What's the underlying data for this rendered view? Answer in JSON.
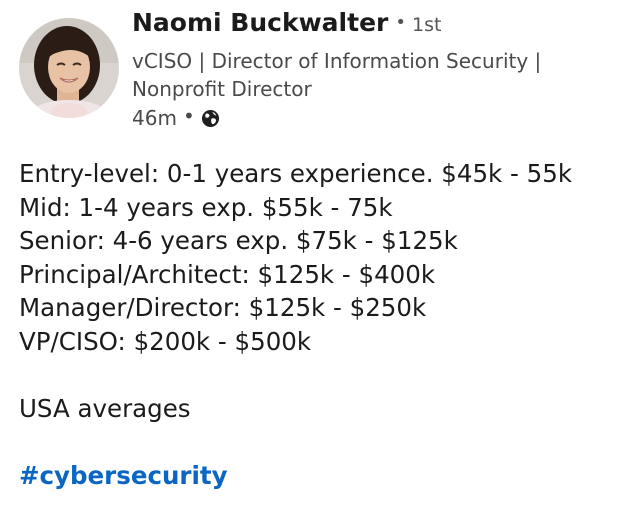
{
  "post": {
    "author": {
      "name": "Naomi Buckwalter",
      "degree": "1st",
      "separator": "•",
      "headline": "vCISO | Director of Information Security | Nonprofit Director",
      "time_ago": "46m",
      "visibility_icon": "globe-icon"
    },
    "body": {
      "lines": [
        "Entry-level: 0-1 years experience. $45k - 55k",
        "Mid: 1-4 years exp. $55k - 75k",
        "Senior: 4-6 years exp. $75k - $125k",
        "Principal/Architect: $125k - $400k",
        "Manager/Director: $125k - $250k",
        "VP/CISO: $200k - $500k"
      ],
      "note": "USA averages",
      "hashtag": "#cybersecurity"
    }
  },
  "colors": {
    "text": "#1b1b1b",
    "secondary_text": "#4a4a4a",
    "hashtag": "#0a66c2"
  }
}
